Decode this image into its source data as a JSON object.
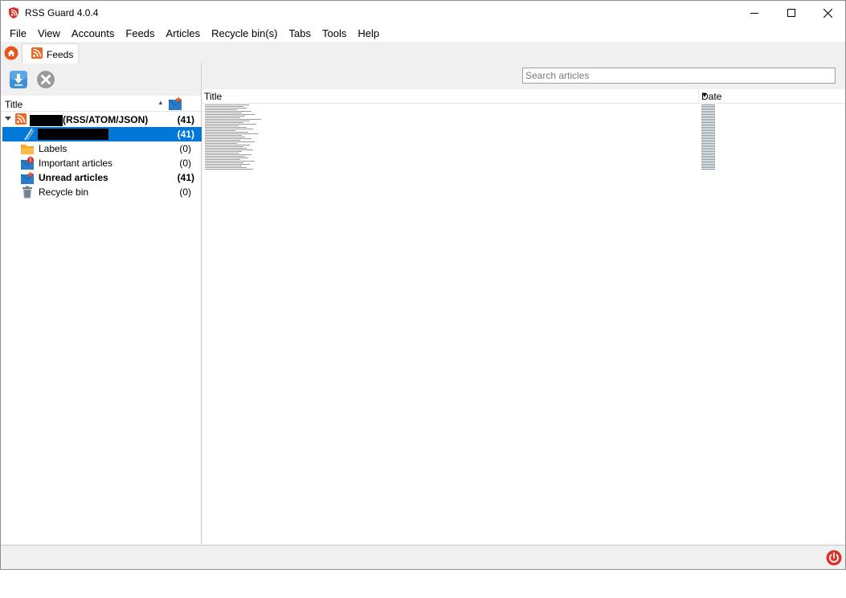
{
  "window": {
    "title": "RSS Guard 4.0.4"
  },
  "menu": [
    "File",
    "View",
    "Accounts",
    "Feeds",
    "Articles",
    "Recycle bin(s)",
    "Tabs",
    "Tools",
    "Help"
  ],
  "tabs": {
    "feeds_label": "Feeds"
  },
  "feeds_panel": {
    "column_title": "Title",
    "account": {
      "suffix": "(RSS/ATOM/JSON)",
      "count": "(41)"
    },
    "feed": {
      "count": "(41)"
    },
    "labels": {
      "label": "Labels",
      "count": "(0)"
    },
    "important": {
      "label": "Important articles",
      "count": "(0)"
    },
    "unread": {
      "label": "Unread articles",
      "count": "(41)"
    },
    "recycle": {
      "label": "Recycle bin",
      "count": "(0)"
    }
  },
  "articles_panel": {
    "search_placeholder": "Search articles",
    "column_title": "Title",
    "column_date": "Date"
  },
  "colors": {
    "selection": "#0078d7",
    "rss_orange": "#f26522",
    "power_red": "#d9332b"
  }
}
